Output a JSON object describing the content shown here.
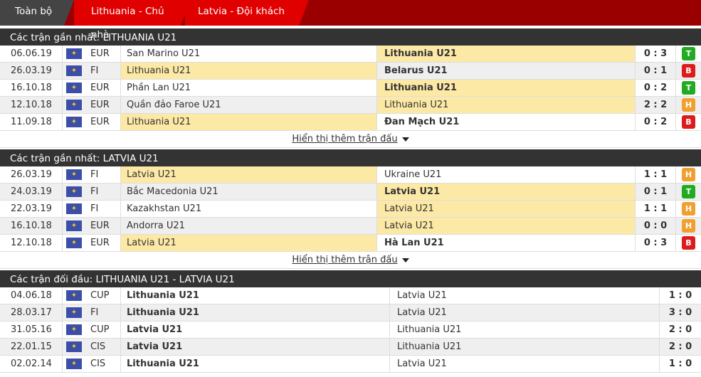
{
  "tabs": [
    "Toàn bộ",
    "Lithuania - Chủ nhà",
    "Latvia - Đội khách"
  ],
  "colors": {
    "win": "#22aa22",
    "lose": "#dd1c1c",
    "draw": "#f0a030",
    "highlight": "#fde9a6"
  },
  "flag_icon": "world-map-icon",
  "show_more": "Hiển thị thêm trận đấu",
  "sections": [
    {
      "title": "Các trận gần nhất: LITHUANIA U21",
      "rows": [
        {
          "date": "06.06.19",
          "comp": "EUR",
          "home": "San Marino U21",
          "away": "Lithuania U21",
          "score": "0 : 3",
          "result": "T",
          "hl": "away",
          "bold": "away"
        },
        {
          "date": "26.03.19",
          "comp": "FI",
          "home": "Lithuania U21",
          "away": "Belarus U21",
          "score": "0 : 1",
          "result": "B",
          "hl": "home",
          "bold": "away"
        },
        {
          "date": "16.10.18",
          "comp": "EUR",
          "home": "Phần Lan U21",
          "away": "Lithuania U21",
          "score": "0 : 2",
          "result": "T",
          "hl": "away",
          "bold": "away"
        },
        {
          "date": "12.10.18",
          "comp": "EUR",
          "home": "Quần đảo Faroe U21",
          "away": "Lithuania U21",
          "score": "2 : 2",
          "result": "H",
          "hl": "away",
          "bold": ""
        },
        {
          "date": "11.09.18",
          "comp": "EUR",
          "home": "Lithuania U21",
          "away": "Đan Mạch U21",
          "score": "0 : 2",
          "result": "B",
          "hl": "home",
          "bold": "away"
        }
      ]
    },
    {
      "title": "Các trận gần nhất: LATVIA U21",
      "rows": [
        {
          "date": "26.03.19",
          "comp": "FI",
          "home": "Latvia U21",
          "away": "Ukraine U21",
          "score": "1 : 1",
          "result": "H",
          "hl": "home",
          "bold": ""
        },
        {
          "date": "24.03.19",
          "comp": "FI",
          "home": "Bắc Macedonia U21",
          "away": "Latvia U21",
          "score": "0 : 1",
          "result": "T",
          "hl": "away",
          "bold": "away"
        },
        {
          "date": "22.03.19",
          "comp": "FI",
          "home": "Kazakhstan U21",
          "away": "Latvia U21",
          "score": "1 : 1",
          "result": "H",
          "hl": "away",
          "bold": ""
        },
        {
          "date": "16.10.18",
          "comp": "EUR",
          "home": "Andorra U21",
          "away": "Latvia U21",
          "score": "0 : 0",
          "result": "H",
          "hl": "away",
          "bold": ""
        },
        {
          "date": "12.10.18",
          "comp": "EUR",
          "home": "Latvia U21",
          "away": "Hà Lan U21",
          "score": "0 : 3",
          "result": "B",
          "hl": "home",
          "bold": "away"
        }
      ]
    }
  ],
  "h2h": {
    "title": "Các trận đối đầu: LITHUANIA U21 - LATVIA U21",
    "rows": [
      {
        "date": "04.06.18",
        "comp": "CUP",
        "home": "Lithuania U21",
        "away": "Latvia U21",
        "score": "1 : 0"
      },
      {
        "date": "28.03.17",
        "comp": "FI",
        "home": "Lithuania U21",
        "away": "Latvia U21",
        "score": "3 : 0"
      },
      {
        "date": "31.05.16",
        "comp": "CUP",
        "home": "Latvia U21",
        "away": "Lithuania U21",
        "score": "2 : 0"
      },
      {
        "date": "22.01.15",
        "comp": "CIS",
        "home": "Latvia U21",
        "away": "Lithuania U21",
        "score": "2 : 0"
      },
      {
        "date": "02.02.14",
        "comp": "CIS",
        "home": "Lithuania U21",
        "away": "Latvia U21",
        "score": "1 : 0"
      }
    ]
  }
}
